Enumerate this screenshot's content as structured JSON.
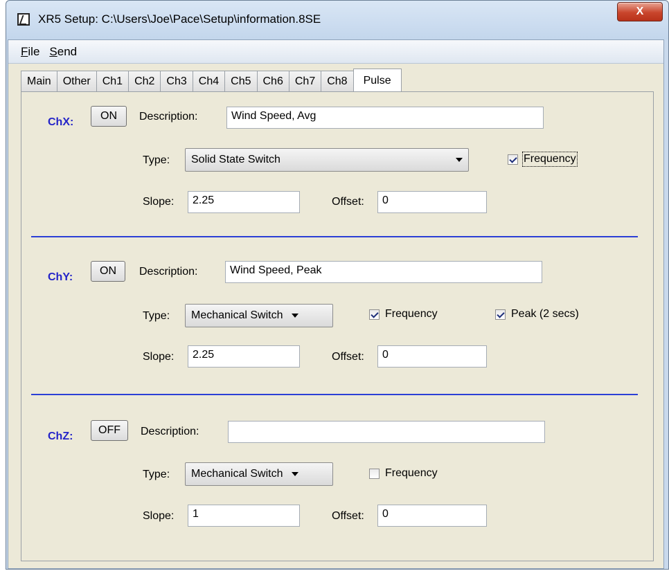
{
  "window": {
    "title": "XR5 Setup: C:\\Users\\Joe\\Pace\\Setup\\information.8SE",
    "close_label": "X"
  },
  "menu": [
    {
      "first": "F",
      "rest": "ile"
    },
    {
      "first": "S",
      "rest": "end"
    }
  ],
  "tabs": [
    "Main",
    "Other",
    "Ch1",
    "Ch2",
    "Ch3",
    "Ch4",
    "Ch5",
    "Ch6",
    "Ch7",
    "Ch8",
    "Pulse"
  ],
  "active_tab": "Pulse",
  "labels": {
    "description": "Description:",
    "type": "Type:",
    "slope": "Slope:",
    "offset": "Offset:",
    "frequency": "Frequency",
    "peak": "Peak (2 secs)"
  },
  "channels": [
    {
      "name": "ChX:",
      "state": "ON",
      "description": "Wind Speed, Avg",
      "type": "Solid State Switch",
      "frequency": true,
      "slope": "2.25",
      "offset": "0"
    },
    {
      "name": "ChY:",
      "state": "ON",
      "description": "Wind Speed, Peak",
      "type": "Mechanical Switch",
      "frequency": true,
      "peak": true,
      "slope": "2.25",
      "offset": "0"
    },
    {
      "name": "ChZ:",
      "state": "OFF",
      "description": "",
      "type": "Mechanical Switch",
      "frequency": false,
      "slope": "1",
      "offset": "0"
    }
  ],
  "colors": {
    "channel_label": "#2424c8",
    "divider": "#2b3fd6",
    "panel_bg": "#ece9d8"
  }
}
